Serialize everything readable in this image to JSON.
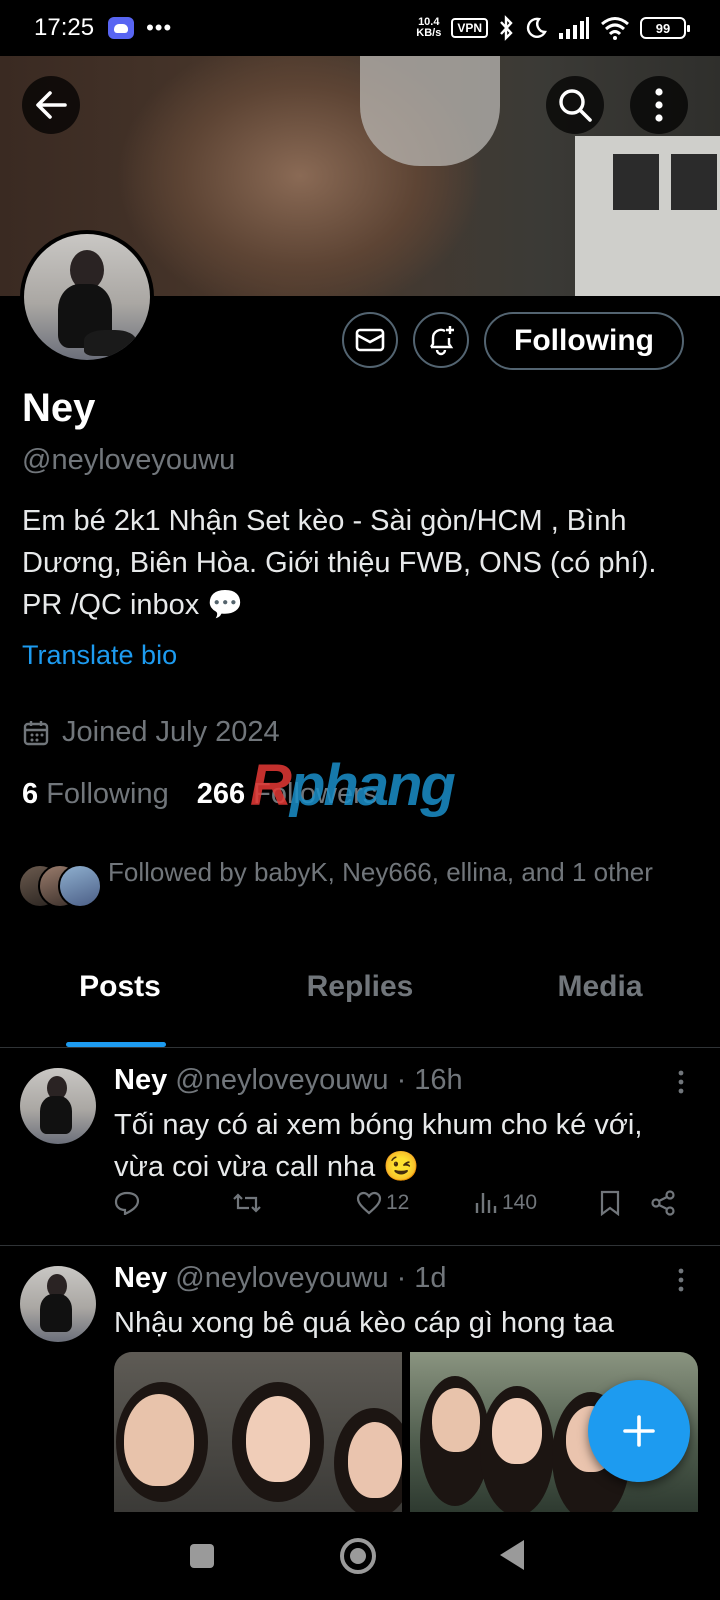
{
  "status_bar": {
    "time": "17:25",
    "more": "•••",
    "net_speed_value": "10.4",
    "net_speed_unit": "KB/s",
    "vpn": "VPN",
    "battery": "99"
  },
  "profile": {
    "display_name": "Ney",
    "handle": "@neyloveyouwu",
    "bio": "Em bé 2k1 Nhận Set kèo - Sài gòn/HCM , Bình Dương, Biên Hòa. Giới thiệu FWB, ONS (có phí). PR /QC inbox 💬",
    "translate_bio": "Translate bio",
    "joined": "Joined July 2024",
    "following_count": "6",
    "following_label": "Following",
    "followers_count": "266",
    "followers_label": "Followers",
    "followed_by": "Followed by babyK, Ney666, ellina, and 1 other",
    "follow_button": "Following"
  },
  "watermark": {
    "part1": "R",
    "part2": "phang"
  },
  "tabs": [
    {
      "label": "Posts",
      "active": true
    },
    {
      "label": "Replies",
      "active": false
    },
    {
      "label": "Media",
      "active": false
    }
  ],
  "tweets": [
    {
      "name": "Ney",
      "handle": "@neyloveyouwu",
      "time": "· 16h",
      "text": "Tối nay có ai xem bóng khum cho ké với, vừa coi vừa call nha 😉",
      "likes": "12",
      "views": "140"
    },
    {
      "name": "Ney",
      "handle": "@neyloveyouwu",
      "time": "· 1d",
      "text": "Nhậu xong bê quá kèo cáp gì hong taa"
    }
  ],
  "icons": {
    "back": "arrow-left-icon",
    "search": "search-icon",
    "more": "more-vertical-icon",
    "message": "envelope-icon",
    "notify": "bell-plus-icon",
    "calendar": "calendar-icon",
    "compose": "plus-icon"
  },
  "colors": {
    "accent": "#1d9bf0",
    "background": "#000000",
    "muted": "#71767b",
    "border": "#536471"
  }
}
